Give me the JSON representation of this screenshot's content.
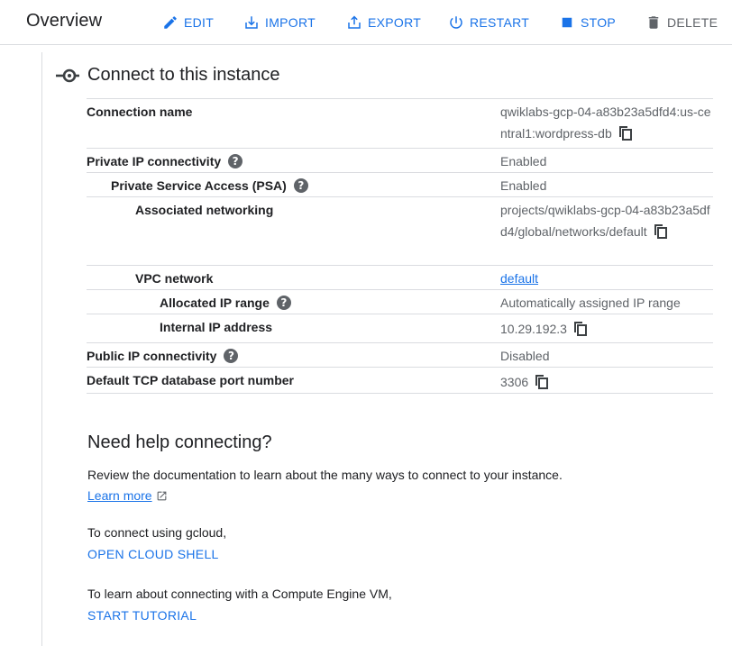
{
  "header": {
    "title": "Overview",
    "actions": [
      {
        "label": "EDIT",
        "icon": "pencil-icon",
        "enabled": true
      },
      {
        "label": "IMPORT",
        "icon": "import-icon",
        "enabled": true
      },
      {
        "label": "EXPORT",
        "icon": "export-icon",
        "enabled": true
      },
      {
        "label": "RESTART",
        "icon": "power-icon",
        "enabled": true
      },
      {
        "label": "STOP",
        "icon": "stop-icon",
        "enabled": true
      },
      {
        "label": "DELETE",
        "icon": "trash-icon",
        "enabled": false
      }
    ]
  },
  "connect": {
    "title": "Connect to this instance",
    "rows": [
      {
        "label": "Connection name",
        "value": "qwiklabs-gcp-04-a83b23a5dfd4:us-central1:wordpress-db"
      },
      {
        "label": "Private IP connectivity",
        "value": "Enabled"
      },
      {
        "label": "Private Service Access (PSA)",
        "value": "Enabled"
      },
      {
        "label": "Associated networking",
        "value": "projects/qwiklabs-gcp-04-a83b23a5dfd4/global/networks/default"
      },
      {
        "label": "VPC network",
        "value": "default"
      },
      {
        "label": "Allocated IP range",
        "value": "Automatically assigned IP range"
      },
      {
        "label": "Internal IP address",
        "value": "10.29.192.3"
      },
      {
        "label": "Public IP connectivity",
        "value": "Disabled"
      },
      {
        "label": "Default TCP database port number",
        "value": "3306"
      }
    ]
  },
  "help": {
    "title": "Need help connecting?",
    "doc_text": "Review the documentation to learn about the many ways to connect to your instance.",
    "learn_more": "Learn more",
    "gcloud_text": "To connect using gcloud,",
    "open_shell": "OPEN CLOUD SHELL",
    "vm_text": "To learn about connecting with a Compute Engine VM,",
    "start_tutorial": "START TUTORIAL"
  },
  "colors": {
    "accent": "#1a73e8",
    "muted": "#5f6368",
    "text": "#202124",
    "divider": "#dadce0"
  }
}
